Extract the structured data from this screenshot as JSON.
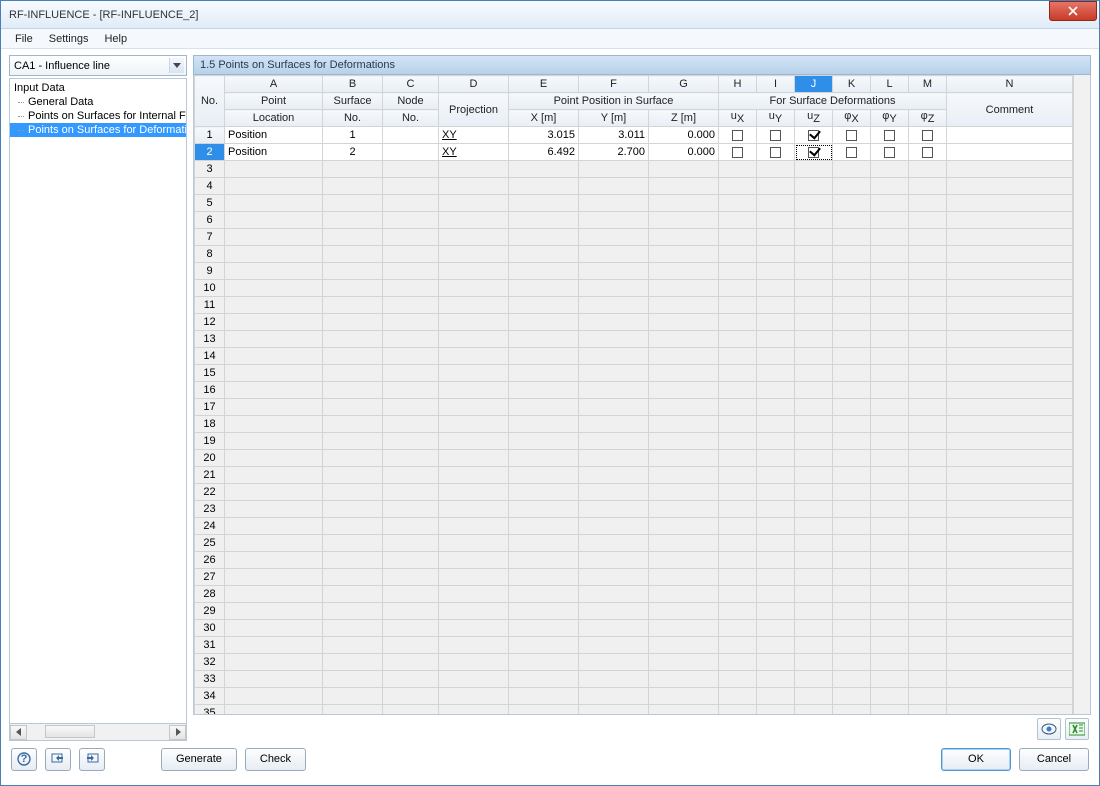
{
  "titlebar": {
    "text": "RF-INFLUENCE - [RF-INFLUENCE_2]"
  },
  "menubar": {
    "file": "File",
    "settings": "Settings",
    "help": "Help"
  },
  "combo": {
    "value": "CA1 - Influence line"
  },
  "tree": {
    "root": "Input Data",
    "items": [
      "General Data",
      "Points on Surfaces for Internal Forces",
      "Points on Surfaces for Deformations"
    ],
    "selected_index": 2
  },
  "panel": {
    "title": "1.5 Points on Surfaces for Deformations"
  },
  "grid": {
    "letters": [
      "A",
      "B",
      "C",
      "D",
      "E",
      "F",
      "G",
      "H",
      "I",
      "J",
      "K",
      "L",
      "M",
      "N"
    ],
    "active_col": "J",
    "group_headers": {
      "no": "No.",
      "point_location": "Point\nLocation",
      "surface_no": "Surface\nNo.",
      "node_no": "Node\nNo.",
      "projection": "Projection",
      "point_position": "Point Position in Surface",
      "x": "X [m]",
      "y": "Y [m]",
      "z": "Z [m]",
      "for_deform": "For Surface Deformations",
      "ux": "u<sub>X</sub>",
      "uy": "u<sub>Y</sub>",
      "uz": "u<sub>Z</sub>",
      "phix": "φ<sub>X</sub>",
      "phiy": "φ<sub>Y</sub>",
      "phiz": "φ<sub>Z</sub>",
      "comment": "Comment"
    },
    "rows": [
      {
        "no": 1,
        "location": "Position",
        "surface": "1",
        "node": "",
        "projection": "XY",
        "x": "3.015",
        "y": "3.011",
        "z": "0.000",
        "ux": false,
        "uy": false,
        "uz": true,
        "phix": false,
        "phiy": false,
        "phiz": false,
        "comment": ""
      },
      {
        "no": 2,
        "location": "Position",
        "surface": "2",
        "node": "",
        "projection": "XY",
        "x": "6.492",
        "y": "2.700",
        "z": "0.000",
        "ux": false,
        "uy": false,
        "uz": true,
        "phix": false,
        "phiy": false,
        "phiz": false,
        "comment": ""
      }
    ],
    "selected_row": 2,
    "focus_cell": {
      "row": 2,
      "col": "J"
    },
    "total_rows": 35
  },
  "buttons": {
    "generate": "Generate",
    "check": "Check",
    "ok": "OK",
    "cancel": "Cancel"
  }
}
